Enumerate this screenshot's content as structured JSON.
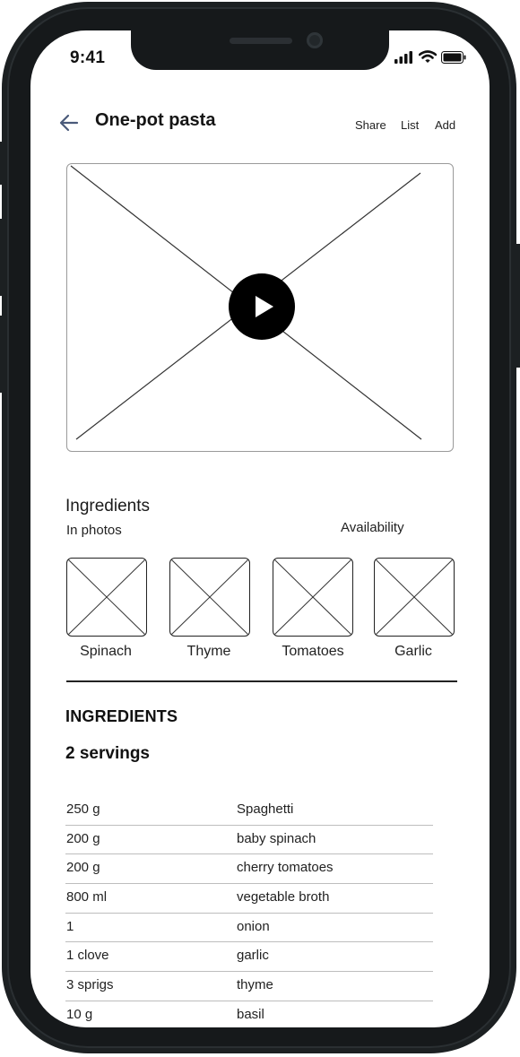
{
  "status_bar": {
    "time": "9:41",
    "icons": [
      "signal-icon",
      "wifi-icon",
      "battery-icon"
    ]
  },
  "header": {
    "back_icon": "arrow-left-icon",
    "title": "One-pot pasta",
    "actions": [
      "Share",
      "List",
      "Add"
    ]
  },
  "video": {
    "placeholder": "image-placeholder",
    "play_icon": "play-icon"
  },
  "ingredients_section": {
    "title": "Ingredients",
    "in_photos_label": "In photos",
    "availability_label": "Availability",
    "photos": [
      {
        "label": "Spinach"
      },
      {
        "label": "Thyme"
      },
      {
        "label": "Tomatoes"
      },
      {
        "label": "Garlic"
      }
    ]
  },
  "ingredients_list": {
    "heading": "INGREDIENTS",
    "servings": "2 servings",
    "rows": [
      {
        "qty": "250 g",
        "name": "Spaghetti"
      },
      {
        "qty": "200 g",
        "name": "baby spinach"
      },
      {
        "qty": "200 g",
        "name": "cherry tomatoes"
      },
      {
        "qty": "800 ml",
        "name": "vegetable broth"
      },
      {
        "qty": "1",
        "name": "onion"
      },
      {
        "qty": "1 clove",
        "name": "garlic"
      },
      {
        "qty": "3 sprigs",
        "name": "thyme"
      },
      {
        "qty": "10 g",
        "name": "basil"
      }
    ]
  },
  "colors": {
    "frame": "#1c2022",
    "accent": "#4a5a7a",
    "text": "#151515"
  }
}
